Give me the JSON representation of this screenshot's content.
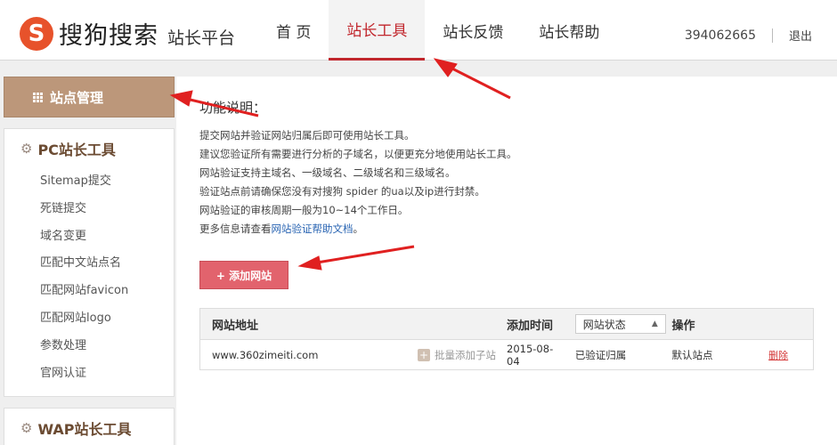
{
  "header": {
    "logo_letter": "S",
    "logo_text": "搜狗搜索",
    "platform": "站长平台",
    "nav": [
      {
        "label": "首 页"
      },
      {
        "label": "站长工具"
      },
      {
        "label": "站长反馈"
      },
      {
        "label": "站长帮助"
      }
    ],
    "user_id": "394062665",
    "logout": "退出"
  },
  "sidebar": {
    "top_item": "站点管理",
    "pc_title": "PC站长工具",
    "pc_items": [
      "Sitemap提交",
      "死链提交",
      "域名变更",
      "匹配中文站点名",
      "匹配网站favicon",
      "匹配网站logo",
      "参数处理",
      "官网认证"
    ],
    "wap_title": "WAP站长工具"
  },
  "main": {
    "func_title": "功能说明：",
    "desc": [
      "提交网站并验证网站归属后即可使用站长工具。",
      "建议您验证所有需要进行分析的子域名，以便更充分地使用站长工具。",
      "网站验证支持主域名、一级域名、二级域名和三级域名。",
      "验证站点前请确保您没有对搜狗 spider 的ua以及ip进行封禁。",
      "网站验证的审核周期一般为10~14个工作日。"
    ],
    "desc_more_prefix": "更多信息请查看",
    "desc_more_link": "网站验证帮助文档",
    "desc_more_suffix": "。",
    "add_button": "+ 添加网站",
    "table": {
      "headers": {
        "site": "网站地址",
        "time": "添加时间",
        "status": "网站状态",
        "op": "操作"
      },
      "rows": [
        {
          "site": "www.360zimeiti.com",
          "batch": "批量添加子站",
          "time": "2015-08-04",
          "status": "已验证归属",
          "op": "默认站点",
          "delete": "删除"
        }
      ]
    }
  },
  "colors": {
    "brand": "#e7522b",
    "accent": "#c1272d",
    "sidebar_active": "#bc977a",
    "button": "#e2636d",
    "arrow": "#e02020"
  }
}
